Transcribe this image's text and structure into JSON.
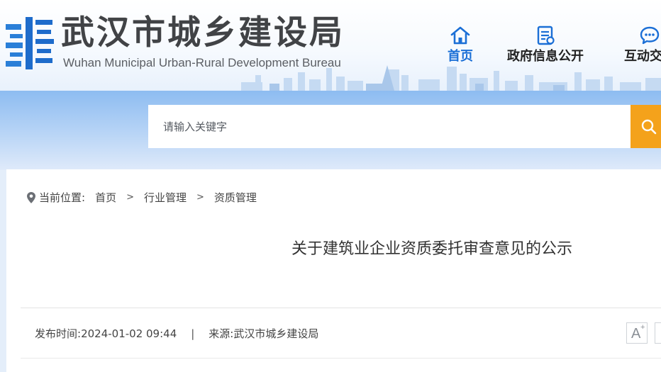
{
  "header": {
    "site_title_cn": "武汉市城乡建设局",
    "site_title_en": "Wuhan Municipal Urban-Rural Development Bureau",
    "logo_icon": "wuhan-bureau-logo-icon",
    "brand_color": "#1b6fd6",
    "nav": [
      {
        "label": "首页",
        "icon": "home-icon",
        "active": true
      },
      {
        "label": "政府信息公开",
        "icon": "document-icon",
        "active": false
      },
      {
        "label": "互动交流",
        "icon": "chat-bubble-icon",
        "active": false
      }
    ]
  },
  "search": {
    "placeholder": "请输入关键字",
    "button_icon": "search-icon",
    "button_color": "#f4a21b"
  },
  "breadcrumb": {
    "icon": "location-pin-icon",
    "label": "当前位置:",
    "items": [
      "首页",
      "行业管理",
      "资质管理"
    ],
    "separator": ">"
  },
  "article": {
    "title": "关于建筑业企业资质委托审查意见的公示",
    "meta": {
      "publish_label": "发布时间:",
      "publish_time": "2024-01-02 09:44",
      "separator": "|",
      "source_label": "来源:",
      "source": "武汉市城乡建设局"
    },
    "font_controls": {
      "larger_icon": "font-size-increase-icon",
      "larger_glyph": "A",
      "larger_superscript": "+"
    }
  }
}
